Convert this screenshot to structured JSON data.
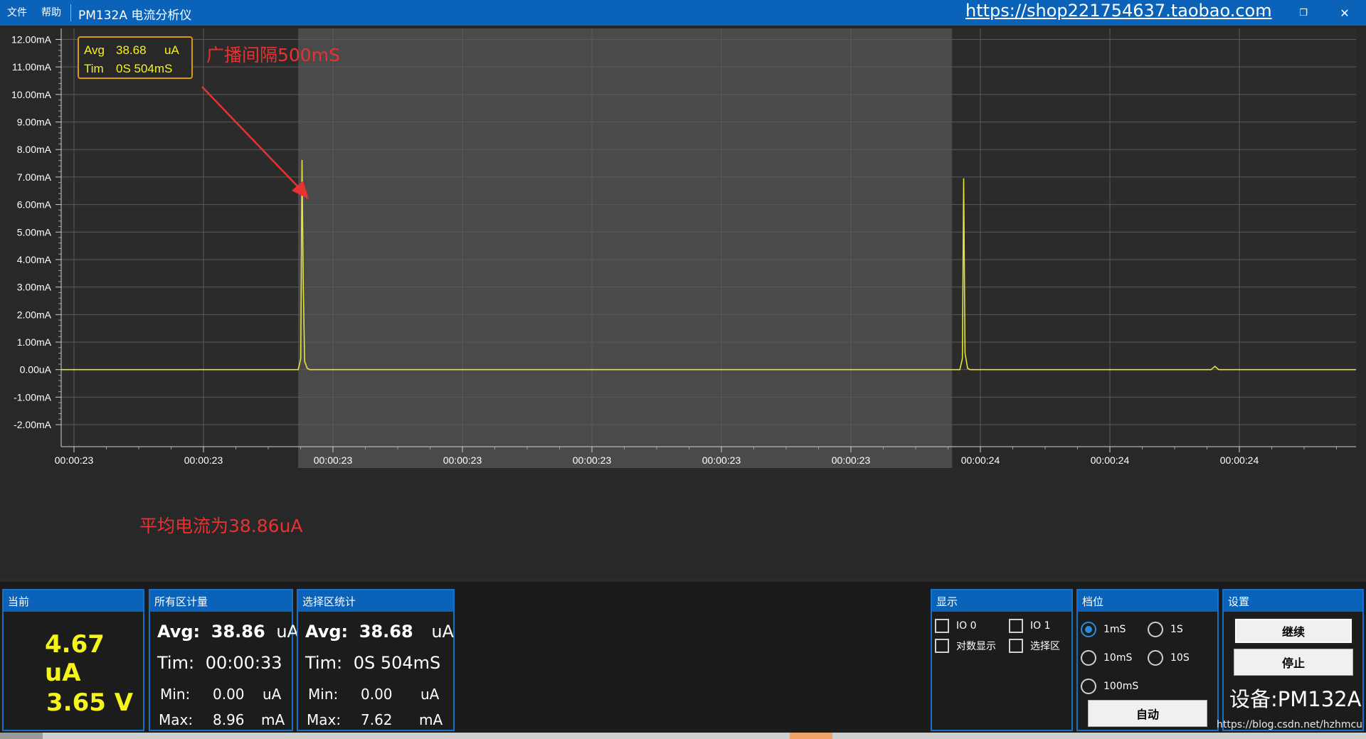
{
  "titlebar": {
    "menu_file": "文件",
    "menu_help": "帮助",
    "title": "PM132A 电流分析仪",
    "link": "https://shop221754637.taobao.com",
    "minimize": "–",
    "restore": "❐",
    "close": "✕"
  },
  "chart_data": {
    "type": "line",
    "y_ticks": [
      "12.00mA",
      "11.00mA",
      "10.00mA",
      "9.00mA",
      "8.00mA",
      "7.00mA",
      "6.00mA",
      "5.00mA",
      "4.00mA",
      "3.00mA",
      "2.00mA",
      "1.00mA",
      "0.00uA",
      "-1.00mA",
      "-2.00mA"
    ],
    "ylim": [
      -2.8,
      12.4
    ],
    "x_ticks": [
      "00:00:23",
      "00:00:23",
      "00:00:23",
      "00:00:23",
      "00:00:23",
      "00:00:23",
      "00:00:23",
      "00:00:24",
      "00:00:24",
      "00:00:24"
    ],
    "xlim": [
      0,
      1000
    ],
    "series": [
      {
        "color": "#e3e33a",
        "x": [
          0,
          183,
          185,
          186,
          187,
          188,
          190,
          192,
          694,
          696,
          697,
          698,
          700,
          702,
          888,
          891,
          894,
          1000
        ],
        "values": [
          0.0,
          0.0,
          0.4,
          7.62,
          3.0,
          0.3,
          0.05,
          0.0,
          0.0,
          0.4,
          6.95,
          0.6,
          0.05,
          0.0,
          0.0,
          0.12,
          0.0,
          0.0
        ]
      }
    ],
    "selection_x": [
      183,
      688
    ],
    "grid": true,
    "colors": {
      "background": "#282828",
      "selection": "#4a4a4a",
      "grid": "#5a5a5a",
      "axis_text": "#ffffff"
    }
  },
  "tooltip": {
    "avg_label": "Avg",
    "avg_value": "38.68",
    "avg_unit": "uA",
    "tim_label": "Tim",
    "tim_value": "0S 504mS",
    "border_color": "#d79a12",
    "text_color": "#f4f41c"
  },
  "annotations": {
    "broadcast": "广播间隔500mS",
    "average": "平均电流为38.86uA",
    "color": "#e83232"
  },
  "panel": {
    "current": {
      "title": "当前",
      "current_value": "4.67 uA",
      "voltage_value": "3.65 V"
    },
    "all": {
      "title": "所有区计量",
      "avg_label": "Avg:",
      "avg_value": "38.86",
      "avg_unit": "uA",
      "tim_label": "Tim:",
      "tim_value": "00:00:33",
      "min_label": "Min:",
      "min_value": "0.00",
      "min_unit": "uA",
      "max_label": "Max:",
      "max_value": "8.96",
      "max_unit": "mA"
    },
    "selection": {
      "title": "选择区统计",
      "avg_label": "Avg:",
      "avg_value": "38.68",
      "avg_unit": "uA",
      "tim_label": "Tim:",
      "tim_value": "0S 504mS",
      "min_label": "Min:",
      "min_value": "0.00",
      "min_unit": "uA",
      "max_label": "Max:",
      "max_value": "7.62",
      "max_unit": "mA"
    },
    "display": {
      "title": "显示",
      "io0": "IO 0",
      "io1": "IO 1",
      "log": "对数显示",
      "select": "选择区"
    },
    "range": {
      "title": "档位",
      "r1ms": "1mS",
      "r1s": "1S",
      "r10ms": "10mS",
      "r10s": "10S",
      "r100ms": "100mS",
      "auto": "自动"
    },
    "settings": {
      "title": "设置",
      "continue": "继续",
      "stop": "停止",
      "device": "设备:PM132A"
    }
  },
  "watermark": "https://blog.csdn.net/hzhmcu"
}
